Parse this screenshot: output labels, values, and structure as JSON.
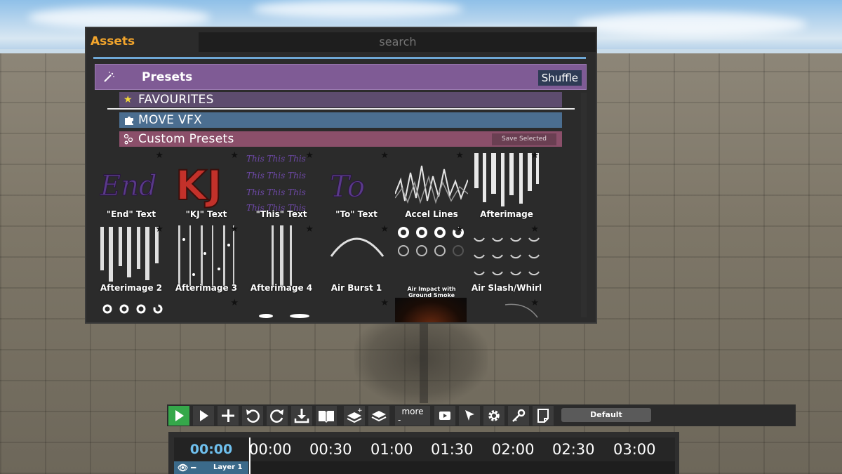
{
  "assets_panel": {
    "title": "Assets",
    "search_placeholder": "search",
    "presets_label": "Presets",
    "shuffle_label": "Shuffle",
    "categories": [
      {
        "label": "FAVOURITES",
        "icon": "star-icon"
      },
      {
        "label": "MOVE VFX",
        "icon": "puzzle-icon"
      },
      {
        "label": "Custom Presets",
        "icon": "nodes-icon"
      }
    ],
    "save_selected_label": "Save Selected",
    "tiles_row1": [
      "\"End\" Text",
      "\"KJ\" Text",
      "\"This\" Text",
      "\"To\" Text",
      "Accel Lines",
      "Afterimage"
    ],
    "tiles_row2": [
      "Afterimage 2",
      "Afterimage 3",
      "Afterimage 4",
      "Air Burst 1",
      "Air Impact with Ground Smoke",
      "Air Slash/Whirl"
    ]
  },
  "toolbar": {
    "more_label": "more",
    "more_sub": "-",
    "preset_value": "Default",
    "icons": [
      "play-icon",
      "step-play-icon",
      "add-icon",
      "undo-icon",
      "redo-icon",
      "import-icon",
      "book-icon",
      "layer-add-icon",
      "layers-icon",
      "preview-icon",
      "cursor-icon",
      "gear-icon",
      "key-icon",
      "page-icon"
    ]
  },
  "timeline": {
    "current_time": "00:00",
    "ticks": [
      "00:00",
      "00:30",
      "01:00",
      "01:30",
      "02:00",
      "02:30",
      "03:00"
    ],
    "layer_name": "Layer 1"
  },
  "colors": {
    "accent_orange": "#f3a52c",
    "presets_purple": "#7f5b95",
    "move_blue": "#4b6e90",
    "custom_pink": "#8b4f6a",
    "time_blue": "#6fc0ee",
    "play_green": "#35a84a"
  }
}
